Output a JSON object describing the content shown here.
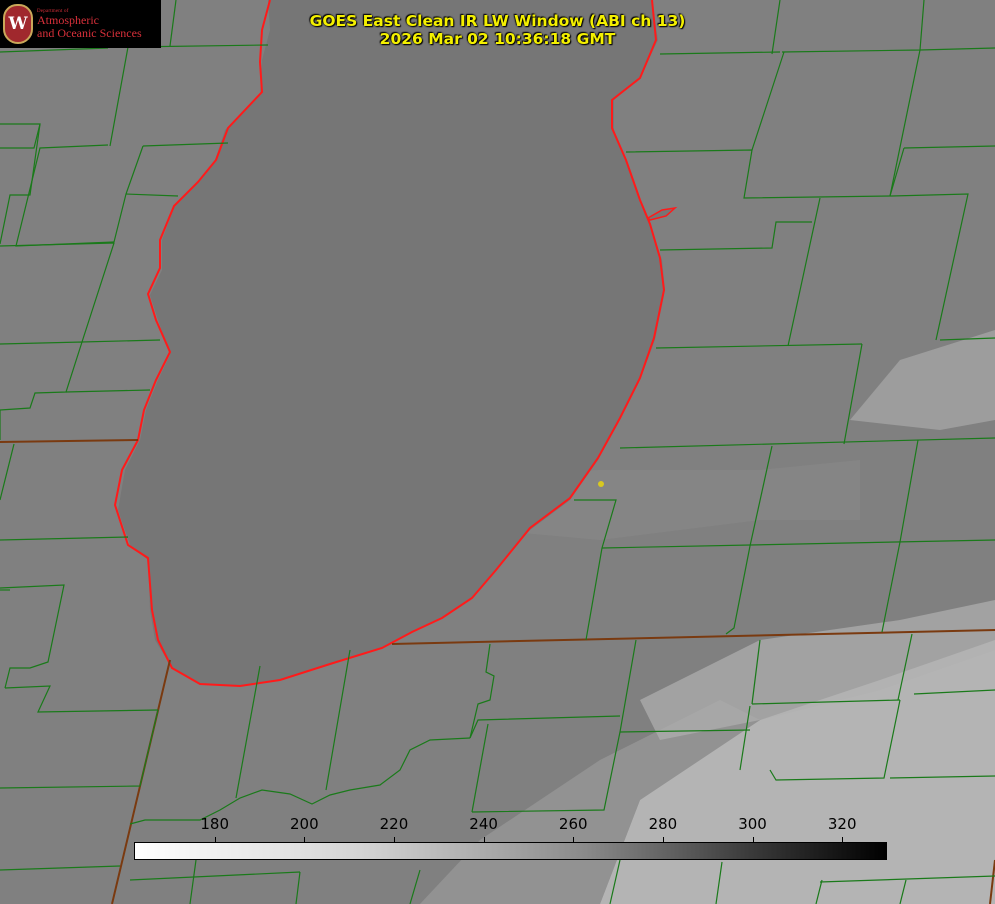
{
  "header": {
    "title": "GOES East Clean IR LW Window (ABI ch 13)",
    "timestamp": "2026 Mar 02 10:36:18 GMT"
  },
  "logo": {
    "dept": "Department of",
    "line1": "Atmospheric",
    "line2": "and Oceanic Sciences",
    "seal": "W"
  },
  "colorbar": {
    "ticks": [
      "180",
      "200",
      "220",
      "240",
      "260",
      "280",
      "300",
      "320"
    ],
    "tick_values": [
      180,
      200,
      220,
      240,
      260,
      280,
      300,
      320
    ],
    "range": [
      162,
      330
    ]
  },
  "colors": {
    "county_lines": "#1a7a1a",
    "state_lines": "#7a3a10",
    "coastline": "#ff1a1a",
    "marker": "#d8c820",
    "title": "#f4f000"
  }
}
